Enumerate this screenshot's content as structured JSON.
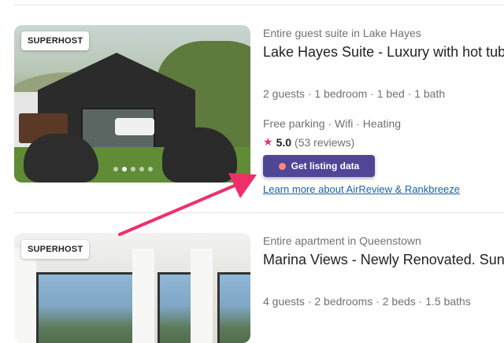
{
  "listings": [
    {
      "badge": "SUPERHOST",
      "type": "Entire guest suite in Lake Hayes",
      "title": "Lake Hayes Suite - Luxury with hot tub",
      "rooms": "2 guests · 1 bedroom · 1 bed · 1 bath",
      "amenities": "Free parking · Wifi · Heating",
      "rating": "5.0",
      "reviews": "(53 reviews)",
      "photo_dots": 5,
      "active_dot": 1
    },
    {
      "badge": "SUPERHOST",
      "type": "Entire apartment in Queenstown",
      "title": "Marina Views - Newly Renovated. Sunny",
      "rooms": "4 guests · 2 bedrooms · 2 beds · 1.5 baths"
    }
  ],
  "extension": {
    "button_label": "Get listing data",
    "learn_link": "Learn more about AirReview & Rankbreeze"
  },
  "colors": {
    "star": "#e8336e",
    "button_bg": "#4f4698",
    "link": "#1d5fa8",
    "arrow": "#ef2f6c"
  },
  "icons": {
    "rating": "star-icon",
    "button": "extension-dot-icon",
    "pointer": "arrow-annotation"
  }
}
